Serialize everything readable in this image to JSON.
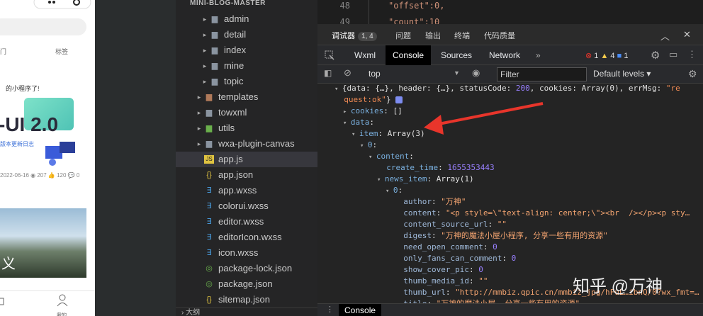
{
  "phone": {
    "tabs": [
      "门",
      "标签"
    ],
    "banner_script": "的小程序了!",
    "banner_title": "-UI 2.0",
    "banner_sub": "版本更新日志",
    "meta": "2022-06-16 ◉ 207 👍 120 💬 0",
    "photo_text": "义",
    "nav_label": "我的"
  },
  "explorer": {
    "title": "MINI-BLOG-MASTER",
    "items": [
      {
        "label": "admin",
        "type": "folder",
        "level": 1,
        "expanded": false
      },
      {
        "label": "detail",
        "type": "folder",
        "level": 1,
        "expanded": false
      },
      {
        "label": "index",
        "type": "folder",
        "level": 1,
        "expanded": false
      },
      {
        "label": "mine",
        "type": "folder",
        "level": 1,
        "expanded": false
      },
      {
        "label": "topic",
        "type": "folder",
        "level": 1,
        "expanded": false
      },
      {
        "label": "templates",
        "type": "folder-templates",
        "level": 0,
        "expanded": false
      },
      {
        "label": "towxml",
        "type": "folder",
        "level": 0,
        "expanded": false
      },
      {
        "label": "utils",
        "type": "folder-utils",
        "level": 0,
        "expanded": false
      },
      {
        "label": "wxa-plugin-canvas",
        "type": "folder",
        "level": 0,
        "expanded": false
      },
      {
        "label": "app.js",
        "type": "js",
        "level": 0,
        "selected": true
      },
      {
        "label": "app.json",
        "type": "json",
        "level": 0
      },
      {
        "label": "app.wxss",
        "type": "wxss",
        "level": 0
      },
      {
        "label": "colorui.wxss",
        "type": "wxss",
        "level": 0
      },
      {
        "label": "editor.wxss",
        "type": "wxss",
        "level": 0
      },
      {
        "label": "editorIcon.wxss",
        "type": "wxss",
        "level": 0
      },
      {
        "label": "icon.wxss",
        "type": "wxss",
        "level": 0
      },
      {
        "label": "package-lock.json",
        "type": "npm",
        "level": 0
      },
      {
        "label": "package.json",
        "type": "npm",
        "level": 0
      },
      {
        "label": "sitemap.json",
        "type": "json",
        "level": 0
      }
    ],
    "footer": "› 大纲"
  },
  "editor": {
    "lines": [
      {
        "num": "48",
        "code": "\"offset\":0,"
      },
      {
        "num": "49",
        "code": "\"count\":10"
      }
    ]
  },
  "devtools": {
    "tabs": [
      {
        "label": "调试器",
        "badge": "1, 4",
        "active": true
      },
      {
        "label": "问题"
      },
      {
        "label": "输出"
      },
      {
        "label": "终端"
      },
      {
        "label": "代码质量"
      }
    ],
    "inspector_tabs": [
      "Wxml",
      "Console",
      "Sources",
      "Network"
    ],
    "active_inspector_tab": "Console",
    "more_tabs": "»",
    "counts": {
      "errors": "1",
      "warnings": "4",
      "info": "1"
    },
    "context": "top",
    "filter_placeholder": "Filter",
    "levels": "Default levels ▾",
    "drawer_tab": "Console",
    "console_lines": [
      {
        "indent": 0,
        "arrow": "▾",
        "parts": [
          [
            "plain",
            "{data: {…}, header: {…}, statusCode: "
          ],
          [
            "n",
            "200"
          ],
          [
            "plain",
            ", cookies: Array(0), errMsg: "
          ],
          [
            "s",
            "\"re"
          ]
        ]
      },
      {
        "indent": 0,
        "arrow": "",
        "parts": [
          [
            "s",
            "quest:ok\""
          ],
          [
            "plain",
            "} "
          ]
        ],
        "info": true
      },
      {
        "indent": 1,
        "arrow": "▸",
        "parts": [
          [
            "k2",
            "cookies"
          ],
          [
            "plain",
            ": []"
          ]
        ]
      },
      {
        "indent": 1,
        "arrow": "▾",
        "parts": [
          [
            "k2",
            "data"
          ],
          [
            "plain",
            ":"
          ]
        ]
      },
      {
        "indent": 2,
        "arrow": "▾",
        "parts": [
          [
            "k2",
            "item"
          ],
          [
            "plain",
            ": Array(3)"
          ]
        ]
      },
      {
        "indent": 3,
        "arrow": "▾",
        "parts": [
          [
            "k2",
            "0"
          ],
          [
            "plain",
            ":"
          ]
        ]
      },
      {
        "indent": 4,
        "arrow": "▾",
        "parts": [
          [
            "k2",
            "content"
          ],
          [
            "plain",
            ":"
          ]
        ]
      },
      {
        "indent": 5,
        "arrow": "",
        "parts": [
          [
            "k2",
            "create_time"
          ],
          [
            "plain",
            ": "
          ],
          [
            "n",
            "1655353443"
          ]
        ]
      },
      {
        "indent": 5,
        "arrow": "▾",
        "parts": [
          [
            "k2",
            "news_item"
          ],
          [
            "plain",
            ": Array(1)"
          ]
        ]
      },
      {
        "indent": 6,
        "arrow": "▾",
        "parts": [
          [
            "k2",
            "0"
          ],
          [
            "plain",
            ":"
          ]
        ]
      },
      {
        "indent": 7,
        "arrow": "",
        "parts": [
          [
            "k",
            "author"
          ],
          [
            "plain",
            ": "
          ],
          [
            "str2",
            "\"万神\""
          ]
        ]
      },
      {
        "indent": 7,
        "arrow": "",
        "parts": [
          [
            "k",
            "content"
          ],
          [
            "plain",
            ": "
          ],
          [
            "str2",
            "\"<p style=\\\"text-align: center;\\\"><br  /></p><p sty…"
          ]
        ]
      },
      {
        "indent": 7,
        "arrow": "",
        "parts": [
          [
            "k",
            "content_source_url"
          ],
          [
            "plain",
            ": "
          ],
          [
            "str2",
            "\"\""
          ]
        ]
      },
      {
        "indent": 7,
        "arrow": "",
        "parts": [
          [
            "k",
            "digest"
          ],
          [
            "plain",
            ": "
          ],
          [
            "str2",
            "\"万神的魔法小屋小程序, 分享一些有用的资源\""
          ]
        ]
      },
      {
        "indent": 7,
        "arrow": "",
        "parts": [
          [
            "k",
            "need_open_comment"
          ],
          [
            "plain",
            ": "
          ],
          [
            "n",
            "0"
          ]
        ]
      },
      {
        "indent": 7,
        "arrow": "",
        "parts": [
          [
            "k",
            "only_fans_can_comment"
          ],
          [
            "plain",
            ": "
          ],
          [
            "n",
            "0"
          ]
        ]
      },
      {
        "indent": 7,
        "arrow": "",
        "parts": [
          [
            "k",
            "show_cover_pic"
          ],
          [
            "plain",
            ": "
          ],
          [
            "n",
            "0"
          ]
        ]
      },
      {
        "indent": 7,
        "arrow": "",
        "parts": [
          [
            "k",
            "thumb_media_id"
          ],
          [
            "plain",
            ": "
          ],
          [
            "str2",
            "\"\""
          ]
        ]
      },
      {
        "indent": 7,
        "arrow": "",
        "parts": [
          [
            "k",
            "thumb_url"
          ],
          [
            "plain",
            ": "
          ],
          [
            "str2",
            "\"http://mmbiz.qpic.cn/mmbiz_jpg/hFuL…ibnQ/0?wx_fmt=…"
          ]
        ]
      },
      {
        "indent": 7,
        "arrow": "",
        "parts": [
          [
            "k",
            "title"
          ],
          [
            "plain",
            ": "
          ],
          [
            "str2",
            "\"万神的魔法小屋, 分享一些有用的资源\""
          ]
        ]
      }
    ],
    "watermark": "知乎 @万神"
  },
  "colors": {
    "accent": "#e8352b",
    "selected": "#37373d"
  }
}
